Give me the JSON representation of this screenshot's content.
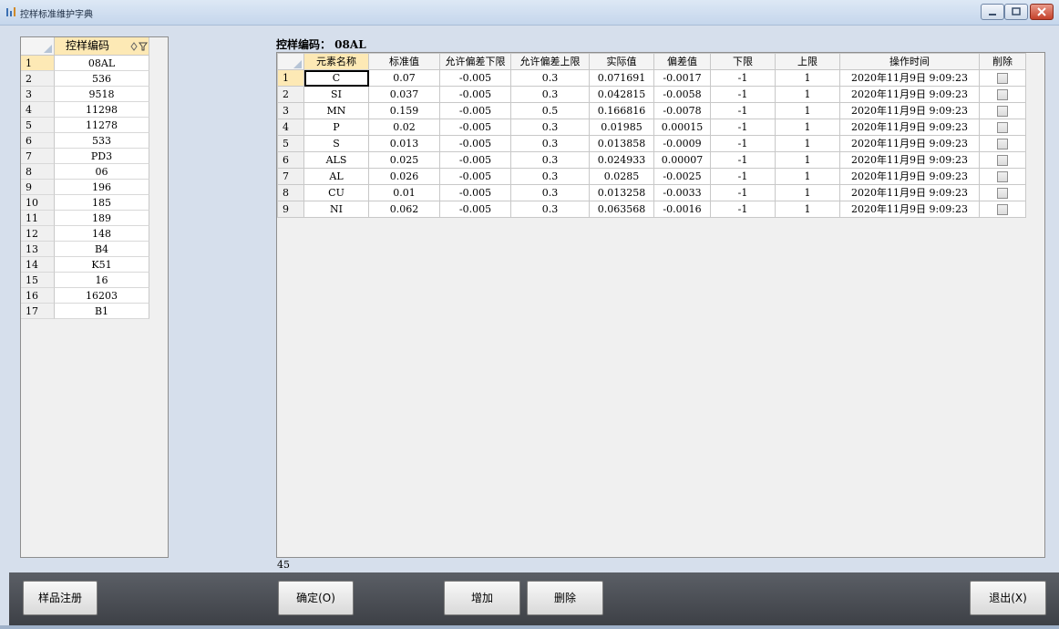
{
  "window": {
    "title": "控样标准维护字典"
  },
  "left_list": {
    "header": "控样编码",
    "selected_index": 0,
    "rows": [
      {
        "num": "1",
        "code": "08AL"
      },
      {
        "num": "2",
        "code": "536"
      },
      {
        "num": "3",
        "code": "9518"
      },
      {
        "num": "4",
        "code": "11298"
      },
      {
        "num": "5",
        "code": "11278"
      },
      {
        "num": "6",
        "code": "533"
      },
      {
        "num": "7",
        "code": "PD3"
      },
      {
        "num": "8",
        "code": "06"
      },
      {
        "num": "9",
        "code": "196"
      },
      {
        "num": "10",
        "code": "185"
      },
      {
        "num": "11",
        "code": "189"
      },
      {
        "num": "12",
        "code": "148"
      },
      {
        "num": "13",
        "code": "B4"
      },
      {
        "num": "14",
        "code": "K51"
      },
      {
        "num": "15",
        "code": "16"
      },
      {
        "num": "16",
        "code": "16203"
      },
      {
        "num": "17",
        "code": "B1"
      }
    ]
  },
  "detail": {
    "label": "控样编码： 08AL",
    "columns": [
      "元素名称",
      "标准值",
      "允许偏差下限",
      "允许偏差上限",
      "实际值",
      "偏差值",
      "下限",
      "上限",
      "操作时间",
      "削除"
    ],
    "rows": [
      {
        "num": "1",
        "element": "C",
        "std": "0.07",
        "dev_low": "-0.005",
        "dev_high": "0.3",
        "actual": "0.071691",
        "deviation": "-0.0017",
        "low": "-1",
        "high": "1",
        "time": "2020年11月9日 9:09:23"
      },
      {
        "num": "2",
        "element": "SI",
        "std": "0.037",
        "dev_low": "-0.005",
        "dev_high": "0.3",
        "actual": "0.042815",
        "deviation": "-0.0058",
        "low": "-1",
        "high": "1",
        "time": "2020年11月9日 9:09:23"
      },
      {
        "num": "3",
        "element": "MN",
        "std": "0.159",
        "dev_low": "-0.005",
        "dev_high": "0.5",
        "actual": "0.166816",
        "deviation": "-0.0078",
        "low": "-1",
        "high": "1",
        "time": "2020年11月9日 9:09:23"
      },
      {
        "num": "4",
        "element": "P",
        "std": "0.02",
        "dev_low": "-0.005",
        "dev_high": "0.3",
        "actual": "0.01985",
        "deviation": "0.00015",
        "low": "-1",
        "high": "1",
        "time": "2020年11月9日 9:09:23"
      },
      {
        "num": "5",
        "element": "S",
        "std": "0.013",
        "dev_low": "-0.005",
        "dev_high": "0.3",
        "actual": "0.013858",
        "deviation": "-0.0009",
        "low": "-1",
        "high": "1",
        "time": "2020年11月9日 9:09:23"
      },
      {
        "num": "6",
        "element": "ALS",
        "std": "0.025",
        "dev_low": "-0.005",
        "dev_high": "0.3",
        "actual": "0.024933",
        "deviation": "0.00007",
        "low": "-1",
        "high": "1",
        "time": "2020年11月9日 9:09:23"
      },
      {
        "num": "7",
        "element": "AL",
        "std": "0.026",
        "dev_low": "-0.005",
        "dev_high": "0.3",
        "actual": "0.0285",
        "deviation": "-0.0025",
        "low": "-1",
        "high": "1",
        "time": "2020年11月9日 9:09:23"
      },
      {
        "num": "8",
        "element": "CU",
        "std": "0.01",
        "dev_low": "-0.005",
        "dev_high": "0.3",
        "actual": "0.013258",
        "deviation": "-0.0033",
        "low": "-1",
        "high": "1",
        "time": "2020年11月9日 9:09:23"
      },
      {
        "num": "9",
        "element": "NI",
        "std": "0.062",
        "dev_low": "-0.005",
        "dev_high": "0.3",
        "actual": "0.063568",
        "deviation": "-0.0016",
        "low": "-1",
        "high": "1",
        "time": "2020年11月9日 9:09:23"
      }
    ],
    "count": "45"
  },
  "buttons": {
    "register": "样品注册",
    "ok": "确定(O)",
    "add": "增加",
    "delete": "删除",
    "exit": "退出(X)"
  },
  "colors": {
    "header_highlight": "#fde9b5",
    "bottom_bar": "#4a4d53"
  }
}
